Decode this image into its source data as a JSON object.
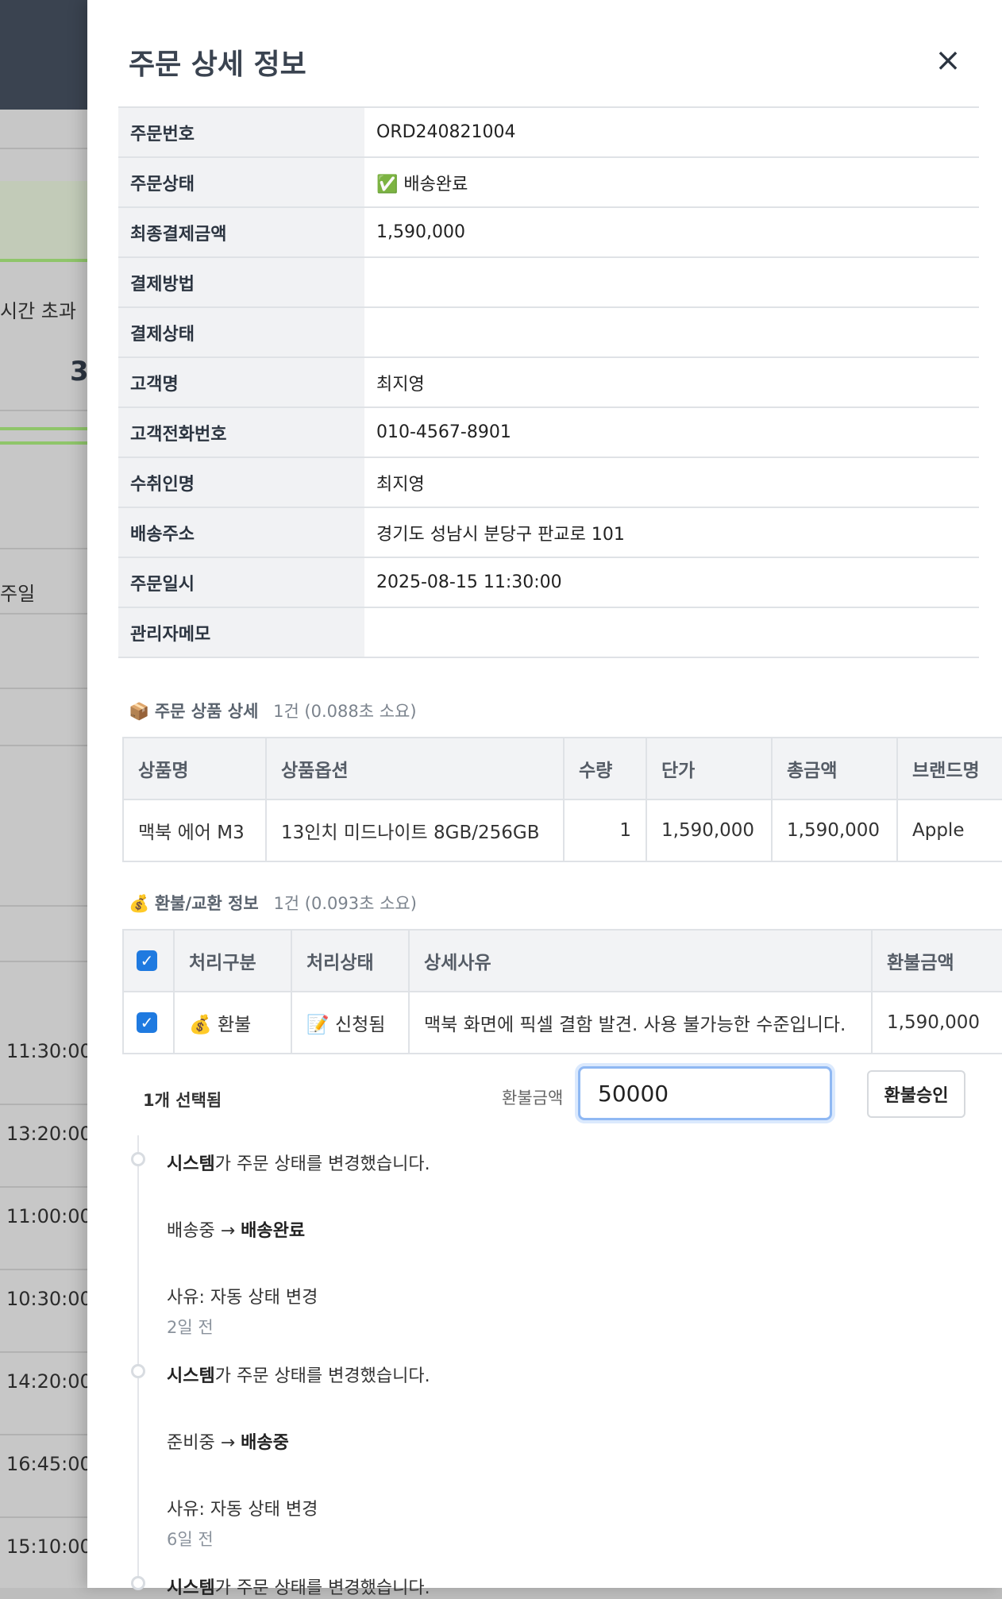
{
  "background": {
    "label_timeout": "시간 초과",
    "big_number": "3",
    "col_label": "주일",
    "times": [
      "11:30:00",
      "13:20:00",
      "11:00:00",
      "10:30:00",
      "14:20:00",
      "16:45:00",
      "15:10:00"
    ]
  },
  "drawer": {
    "title": "주문 상세 정보",
    "close_icon": "×"
  },
  "order_info": [
    {
      "key": "주문번호",
      "value": "ORD240821004"
    },
    {
      "key": "주문상태",
      "value": "✅ 배송완료"
    },
    {
      "key": "최종결제금액",
      "value": "1,590,000"
    },
    {
      "key": "결제방법",
      "value": ""
    },
    {
      "key": "결제상태",
      "value": ""
    },
    {
      "key": "고객명",
      "value": "최지영"
    },
    {
      "key": "고객전화번호",
      "value": "010-4567-8901"
    },
    {
      "key": "수취인명",
      "value": "최지영"
    },
    {
      "key": "배송주소",
      "value": "경기도 성남시 분당구 판교로 101"
    },
    {
      "key": "주문일시",
      "value": "2025-08-15 11:30:00"
    },
    {
      "key": "관리자메모",
      "value": ""
    }
  ],
  "products_section": {
    "icon": "📦",
    "title": "주문 상품 상세",
    "count": "1건 (0.088초 소요)",
    "headers": [
      "상품명",
      "상품옵션",
      "수량",
      "단가",
      "총금액",
      "브랜드명"
    ],
    "rows": [
      [
        "맥북 에어 M3",
        "13인치 미드나이트 8GB/256GB",
        "1",
        "1,590,000",
        "1,590,000",
        "Apple"
      ]
    ]
  },
  "refund_section": {
    "icon": "💰",
    "title": "환불/교환 정보",
    "count": "1건 (0.093초 소요)",
    "headers": [
      "처리구분",
      "처리상태",
      "상세사유",
      "환불금액"
    ],
    "rows": [
      {
        "type": "💰 환불",
        "status": "📝 신청됨",
        "reason": "맥북 화면에 픽셀 결함 발견. 사용 불가능한 수준입니다.",
        "amount": "1,590,000"
      }
    ],
    "selected_text": "1개 선택됨",
    "amount_label": "환불금액",
    "amount_value": "50000",
    "approve_button": "환불승인"
  },
  "timeline": [
    {
      "actor": "시스템",
      "action": "가 주문 상태를 변경했습니다.",
      "from": "배송중",
      "arrow": "→",
      "to": "배송완료",
      "reason": "사유: 자동 상태 변경",
      "time": "2일 전"
    },
    {
      "actor": "시스템",
      "action": "가 주문 상태를 변경했습니다.",
      "from": "준비중",
      "arrow": "→",
      "to": "배송중",
      "reason": "사유: 자동 상태 변경",
      "time": "6일 전"
    },
    {
      "actor": "시스템",
      "action": "가 주문 상태를 변경했습니다."
    }
  ]
}
